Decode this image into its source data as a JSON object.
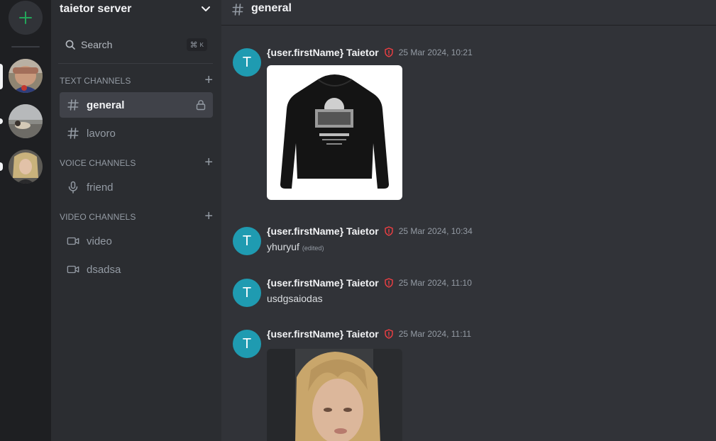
{
  "server": {
    "name": "taietor server",
    "add_button_label": "+"
  },
  "search": {
    "label": "Search",
    "shortcut": "⌘",
    "shortcut_key": "K"
  },
  "categories": [
    {
      "label": "TEXT CHANNELS",
      "add": "+"
    },
    {
      "label": "VOICE CHANNELS",
      "add": "+"
    },
    {
      "label": "VIDEO CHANNELS",
      "add": "+"
    }
  ],
  "channels": {
    "text": [
      {
        "label": "general",
        "icon": "hash-icon",
        "active": true,
        "locked": true
      },
      {
        "label": "lavoro",
        "icon": "hash-icon",
        "active": false
      }
    ],
    "voice": [
      {
        "label": "friend",
        "icon": "microphone-icon"
      }
    ],
    "video": [
      {
        "label": "video",
        "icon": "video-camera-icon"
      },
      {
        "label": "dsadsa",
        "icon": "video-camera-icon"
      }
    ]
  },
  "topbar": {
    "channel": "general",
    "icon": "hash-icon"
  },
  "messages": [
    {
      "avatar": "T",
      "author": "{user.firstName} Taietor",
      "time": "25 Mar 2024, 10:21",
      "text": "",
      "attachment": "black hoodie image"
    },
    {
      "avatar": "T",
      "author": "{user.firstName} Taietor",
      "time": "25 Mar 2024, 10:34",
      "text": "yhuryuf",
      "edited": "(edited)"
    },
    {
      "avatar": "T",
      "author": "{user.firstName} Taietor",
      "time": "25 Mar 2024, 11:10",
      "text": "usdgsaiodas"
    },
    {
      "avatar": "T",
      "author": "{user.firstName} Taietor",
      "time": "25 Mar 2024, 11:11",
      "text": "",
      "attachment": "portrait photo"
    }
  ],
  "colors": {
    "accent_green": "#23a55a",
    "avatar_teal": "#1f9bb1",
    "shield_red": "#f23f43",
    "rail_bg": "#1e1f22",
    "sidebar_bg": "#2b2d31",
    "main_bg": "#313338"
  }
}
